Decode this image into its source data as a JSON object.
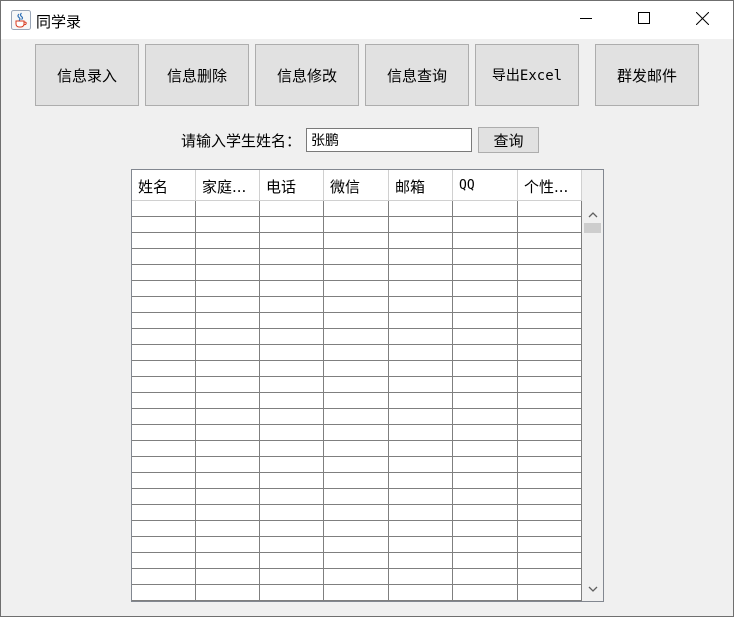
{
  "window": {
    "title": "同学录",
    "icon": "java-cup-icon"
  },
  "toolbar": {
    "buttons": [
      {
        "label": "信息录入"
      },
      {
        "label": "信息删除"
      },
      {
        "label": "信息修改"
      },
      {
        "label": "信息查询"
      },
      {
        "label": "导出Excel"
      },
      {
        "label": "群发邮件"
      }
    ]
  },
  "search": {
    "label": "请输入学生姓名：",
    "value": "张鹏",
    "button_label": "查询"
  },
  "table": {
    "columns": [
      "姓名",
      "家庭...",
      "电话",
      "微信",
      "邮箱",
      "QQ",
      "个性..."
    ],
    "rows": []
  }
}
